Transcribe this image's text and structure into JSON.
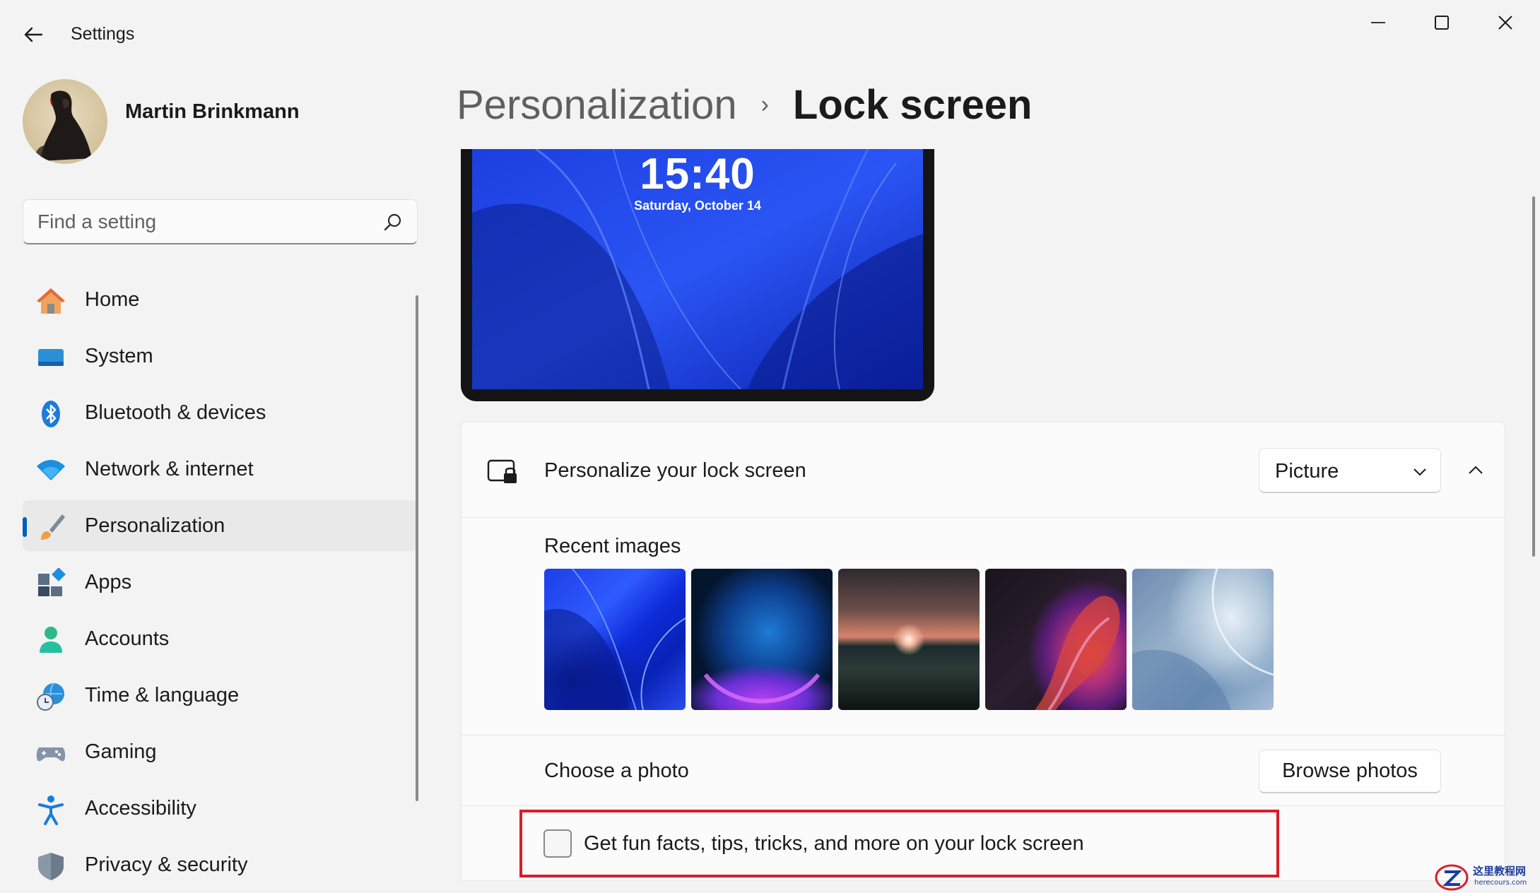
{
  "window": {
    "title": "Settings"
  },
  "profile": {
    "name": "Martin Brinkmann"
  },
  "search": {
    "placeholder": "Find a setting"
  },
  "nav": {
    "items": [
      {
        "label": "Home",
        "icon": "home-icon"
      },
      {
        "label": "System",
        "icon": "system-icon"
      },
      {
        "label": "Bluetooth & devices",
        "icon": "bluetooth-icon"
      },
      {
        "label": "Network & internet",
        "icon": "wifi-icon"
      },
      {
        "label": "Personalization",
        "icon": "paintbrush-icon",
        "active": true
      },
      {
        "label": "Apps",
        "icon": "apps-icon"
      },
      {
        "label": "Accounts",
        "icon": "person-icon"
      },
      {
        "label": "Time & language",
        "icon": "globe-clock-icon"
      },
      {
        "label": "Gaming",
        "icon": "gamepad-icon"
      },
      {
        "label": "Accessibility",
        "icon": "accessibility-icon"
      },
      {
        "label": "Privacy & security",
        "icon": "shield-icon"
      }
    ]
  },
  "breadcrumb": {
    "parent": "Personalization",
    "separator": "›",
    "current": "Lock screen"
  },
  "preview": {
    "time": "15:40",
    "date": "Saturday, October 14"
  },
  "lock_screen": {
    "title": "Personalize your lock screen",
    "selected": "Picture",
    "recent_images_label": "Recent images",
    "recent_images": [
      "blue-bloom",
      "blue-orb",
      "sunset-lake",
      "color-ribbon",
      "pale-bloom"
    ],
    "choose_photo_label": "Choose a photo",
    "browse_button": "Browse photos",
    "tips_label": "Get fun facts, tips, tricks, and more on your lock screen",
    "tips_checked": false
  },
  "colors": {
    "accent": "#005fb8",
    "highlight": "#d81e2a",
    "background": "#f3f3f3"
  },
  "watermark": {
    "text": "这里教程网",
    "sub": "herecours.com"
  }
}
